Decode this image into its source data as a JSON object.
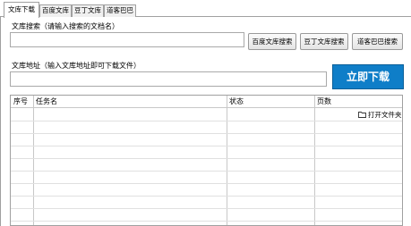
{
  "tabs": [
    {
      "label": "文库下载",
      "active": true
    },
    {
      "label": "百度文库",
      "active": false
    },
    {
      "label": "豆丁文库",
      "active": false
    },
    {
      "label": "道客巴巴",
      "active": false
    }
  ],
  "search": {
    "label": "文库搜索（请输入搜索的文档名）",
    "value": "",
    "buttons": [
      "百度文库搜索",
      "豆丁文库搜索",
      "道客巴巴搜索"
    ]
  },
  "address": {
    "label": "文库地址（输入文库地址即可下载文件）",
    "value": "",
    "download_label": "立即下载",
    "accent": "#0f7ec8"
  },
  "table": {
    "columns": [
      "序号",
      "任务名",
      "状态",
      "页数"
    ],
    "open_folder_label": "打开文件夹",
    "open_folder_icon": "folder-icon",
    "rows": []
  }
}
